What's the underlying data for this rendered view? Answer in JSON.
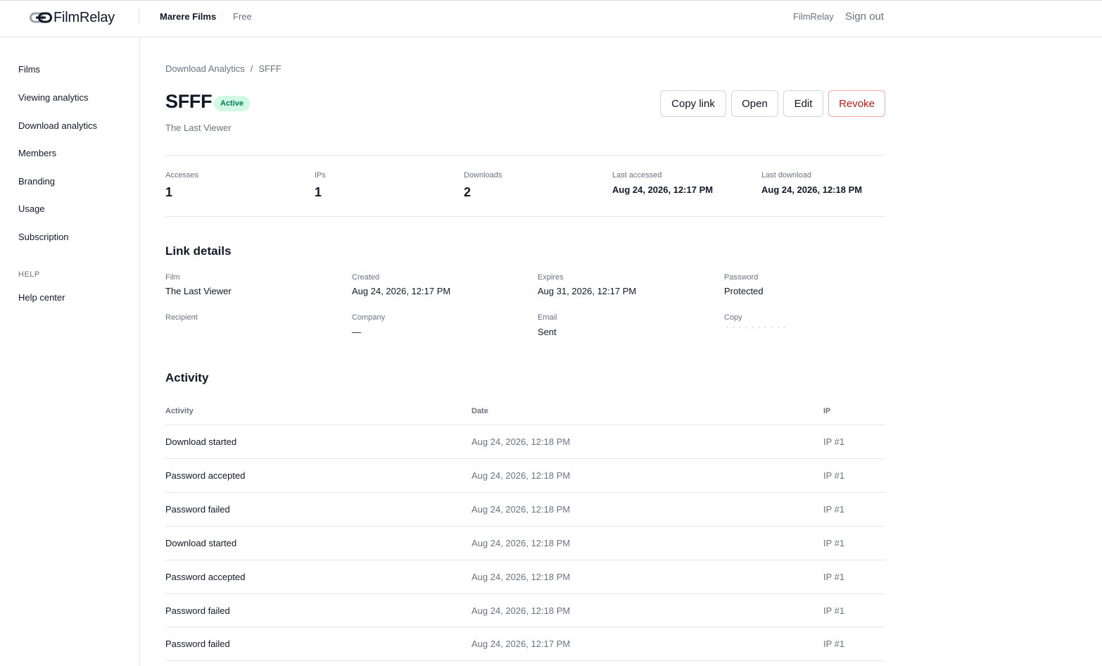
{
  "header": {
    "brand": "FilmRelay",
    "org_name": "Marere Films",
    "separator": "·",
    "plan": "Free",
    "right_brand": "FilmRelay",
    "sign_out": "Sign out"
  },
  "sidebar": {
    "items": [
      {
        "label": "Films"
      },
      {
        "label": "Viewing analytics"
      },
      {
        "label": "Download analytics"
      },
      {
        "label": "Members"
      },
      {
        "label": "Branding"
      },
      {
        "label": "Usage"
      },
      {
        "label": "Subscription"
      }
    ],
    "help_heading": "HELP",
    "help_items": [
      {
        "label": "Help center"
      }
    ]
  },
  "breadcrumb": {
    "parent": "Download Analytics",
    "separator": "/",
    "current": "SFFF"
  },
  "page": {
    "title": "SFFF",
    "status": "Active",
    "subtitle": "The Last Viewer"
  },
  "actions": {
    "copy_link": "Copy link",
    "open": "Open",
    "edit": "Edit",
    "revoke": "Revoke"
  },
  "stats": [
    {
      "label": "Accesses",
      "value": "1"
    },
    {
      "label": "IPs",
      "value": "1"
    },
    {
      "label": "Downloads",
      "value": "2"
    },
    {
      "label": "Last accessed",
      "value": "Aug 24, 2026, 12:17 PM"
    },
    {
      "label": "Last download",
      "value": "Aug 24, 2026, 12:18 PM"
    }
  ],
  "link_details": {
    "title": "Link details",
    "fields": [
      {
        "label": "Film",
        "value": "The Last Viewer"
      },
      {
        "label": "Created",
        "value": "Aug 24, 2026, 12:17 PM"
      },
      {
        "label": "Expires",
        "value": "Aug 31, 2026, 12:17 PM"
      },
      {
        "label": "Password",
        "value": "Protected"
      },
      {
        "label": "Recipient",
        "value": ""
      },
      {
        "label": "Company",
        "value": "—"
      },
      {
        "label": "Email",
        "value": "Sent"
      },
      {
        "label": "Copy",
        "value": ""
      }
    ]
  },
  "activity": {
    "title": "Activity",
    "columns": [
      "Activity",
      "Date",
      "IP"
    ],
    "rows": [
      {
        "activity": "Download started",
        "date": "Aug 24, 2026, 12:18 PM",
        "ip": "IP #1"
      },
      {
        "activity": "Password accepted",
        "date": "Aug 24, 2026, 12:18 PM",
        "ip": "IP #1"
      },
      {
        "activity": "Password failed",
        "date": "Aug 24, 2026, 12:18 PM",
        "ip": "IP #1"
      },
      {
        "activity": "Download started",
        "date": "Aug 24, 2026, 12:18 PM",
        "ip": "IP #1"
      },
      {
        "activity": "Password accepted",
        "date": "Aug 24, 2026, 12:18 PM",
        "ip": "IP #1"
      },
      {
        "activity": "Password failed",
        "date": "Aug 24, 2026, 12:18 PM",
        "ip": "IP #1"
      },
      {
        "activity": "Password failed",
        "date": "Aug 24, 2026, 12:17 PM",
        "ip": "IP #1"
      }
    ]
  }
}
